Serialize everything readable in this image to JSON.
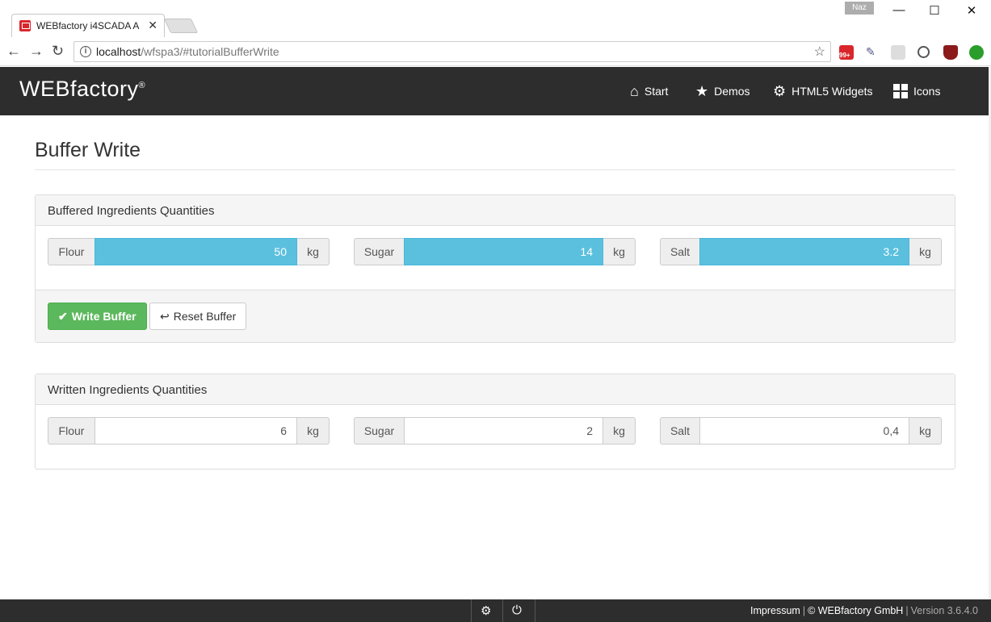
{
  "browser": {
    "tab_title": "WEBfactory i4SCADA App",
    "user_badge": "Naz",
    "url_host": "localhost",
    "url_path": "/wfspa3/#tutorialBufferWrite",
    "extension_badge": "99+"
  },
  "header": {
    "logo_text": "WEBfactory",
    "logo_mark": "®",
    "nav": [
      {
        "label": "Start",
        "icon": "home-icon"
      },
      {
        "label": "Demos",
        "icon": "star-icon"
      },
      {
        "label": "HTML5 Widgets",
        "icon": "gear-icon"
      },
      {
        "label": "Icons",
        "icon": "grid-icon"
      }
    ]
  },
  "page": {
    "title": "Buffer Write"
  },
  "buffered": {
    "heading": "Buffered Ingredients Quantities",
    "items": [
      {
        "label": "Flour",
        "value": "50",
        "unit": "kg"
      },
      {
        "label": "Sugar",
        "value": "14",
        "unit": "kg"
      },
      {
        "label": "Salt",
        "value": "3.2",
        "unit": "kg"
      }
    ],
    "write_button": "Write Buffer",
    "reset_button": "Reset Buffer"
  },
  "written": {
    "heading": "Written Ingredients Quantities",
    "items": [
      {
        "label": "Flour",
        "value": "6",
        "unit": "kg"
      },
      {
        "label": "Sugar",
        "value": "2",
        "unit": "kg"
      },
      {
        "label": "Salt",
        "value": "0,4",
        "unit": "kg"
      }
    ]
  },
  "footer": {
    "impressum": "Impressum",
    "copyright": "© WEBfactory GmbH",
    "version": "Version 3.6.4.0"
  },
  "colors": {
    "header_bg": "#2d2d2d",
    "buffered_fill": "#5bc0de",
    "success": "#5cb85c"
  }
}
